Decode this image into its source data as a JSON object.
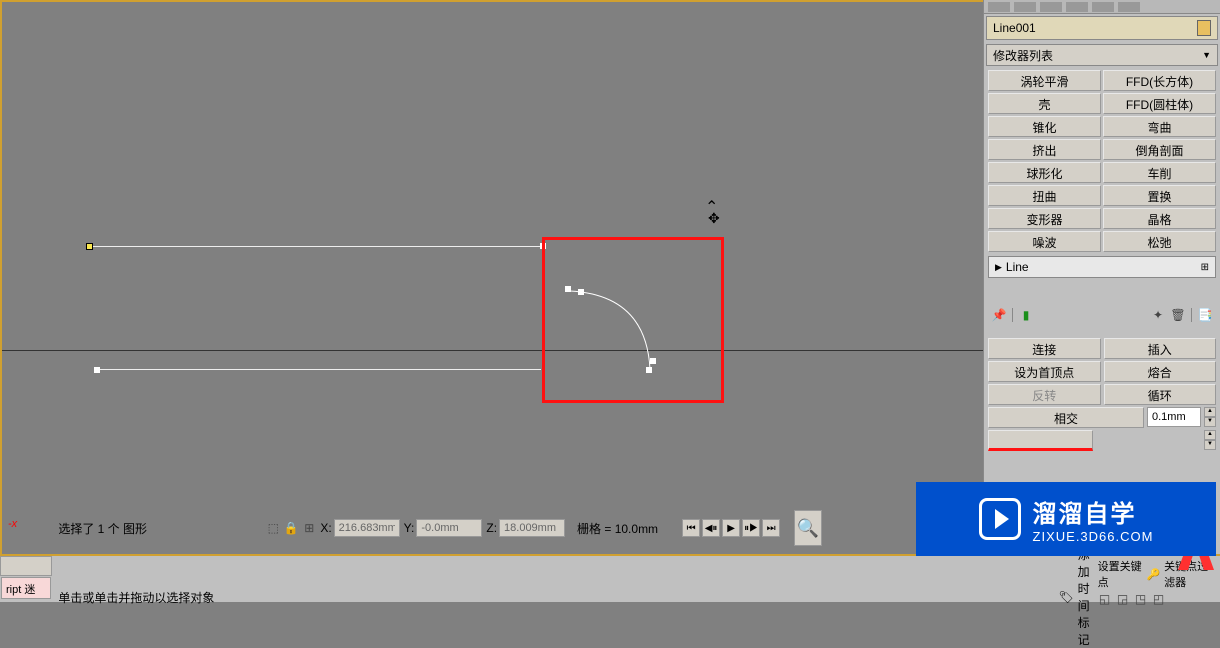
{
  "object_name": "Line001",
  "modifier_dropdown": "修改器列表",
  "modifiers": [
    [
      "涡轮平滑",
      "FFD(长方体)"
    ],
    [
      "壳",
      "FFD(圆柱体)"
    ],
    [
      "锥化",
      "弯曲"
    ],
    [
      "挤出",
      "倒角剖面"
    ],
    [
      "球形化",
      "车削"
    ],
    [
      "扭曲",
      "置换"
    ],
    [
      "变形器",
      "晶格"
    ],
    [
      "噪波",
      "松弛"
    ]
  ],
  "stack_item": "Line",
  "params": {
    "connect": "连接",
    "insert": "插入",
    "set_first": "设为首顶点",
    "fuse": "熔合",
    "reverse": "反转",
    "cycle": "循环",
    "intersect": "相交",
    "intersect_val": "0.1mm"
  },
  "status": {
    "selection": "选择了 1 个 图形",
    "prompt": "单击或单击并拖动以选择对象"
  },
  "coords": {
    "x_label": "X:",
    "x_val": "216.683mm",
    "y_label": "Y:",
    "y_val": "-0.0mm",
    "z_label": "Z:",
    "z_val": "18.009mm",
    "grid": "栅格 = 10.0mm"
  },
  "time_tag": "添加时间标记",
  "bottom_right": {
    "key_point": "设置关键点",
    "key_filter": "关键点过滤器"
  },
  "axis": "-x",
  "watermark": {
    "title": "溜溜自学",
    "url": "ZIXUE.3D66.COM"
  },
  "script_label": "ript 迷"
}
